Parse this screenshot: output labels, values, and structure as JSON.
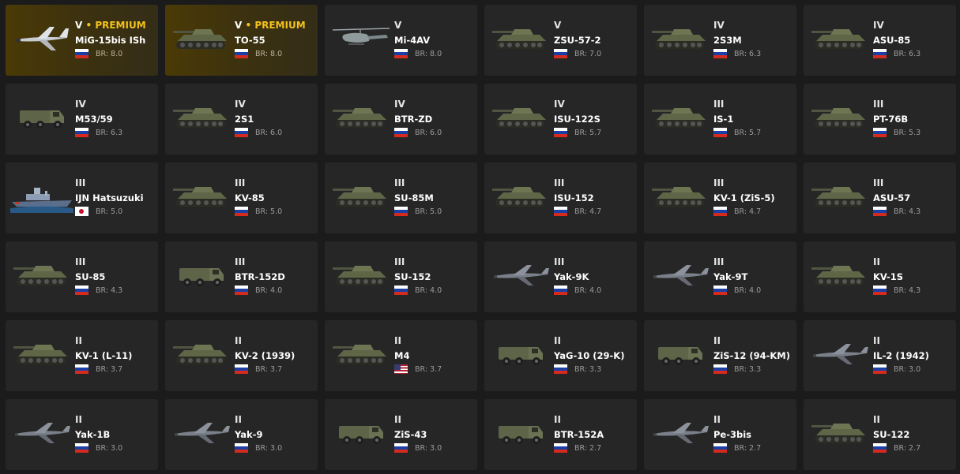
{
  "colors": {
    "background": "#1b1b1b",
    "card": "#262626",
    "premium_card": "#3b3110",
    "premium_text": "#f4c21b",
    "br_text": "#9a9a9a"
  },
  "vehicles": [
    {
      "rank": "V",
      "premium": true,
      "premium_label": "PREMIUM",
      "name": "MiG-15bis ISh",
      "flag": "ussr",
      "br": "BR: 8.0",
      "icon": "jet-icon"
    },
    {
      "rank": "V",
      "premium": true,
      "premium_label": "PREMIUM",
      "name": "TO-55",
      "flag": "ussr",
      "br": "BR: 8.0",
      "icon": "tank-icon"
    },
    {
      "rank": "V",
      "premium": false,
      "name": "Mi-4AV",
      "flag": "ussr",
      "br": "BR: 8.0",
      "icon": "helicopter-icon"
    },
    {
      "rank": "V",
      "premium": false,
      "name": "ZSU-57-2",
      "flag": "ussr",
      "br": "BR: 7.0",
      "icon": "tank-icon"
    },
    {
      "rank": "IV",
      "premium": false,
      "name": "2S3M",
      "flag": "ussr",
      "br": "BR: 6.3",
      "icon": "tank-icon"
    },
    {
      "rank": "IV",
      "premium": false,
      "name": "ASU-85",
      "flag": "ussr",
      "br": "BR: 6.3",
      "icon": "tank-icon"
    },
    {
      "rank": "IV",
      "premium": false,
      "name": "M53/59",
      "flag": "ussr",
      "br": "BR: 6.3",
      "icon": "truck-icon"
    },
    {
      "rank": "IV",
      "premium": false,
      "name": "2S1",
      "flag": "ussr",
      "br": "BR: 6.0",
      "icon": "tank-icon"
    },
    {
      "rank": "IV",
      "premium": false,
      "name": "BTR-ZD",
      "flag": "ussr",
      "br": "BR: 6.0",
      "icon": "tank-icon"
    },
    {
      "rank": "IV",
      "premium": false,
      "name": "ISU-122S",
      "flag": "ussr",
      "br": "BR: 5.7",
      "icon": "tank-icon"
    },
    {
      "rank": "III",
      "premium": false,
      "name": "IS-1",
      "flag": "ussr",
      "br": "BR: 5.7",
      "icon": "tank-icon"
    },
    {
      "rank": "III",
      "premium": false,
      "name": "PT-76B",
      "flag": "ussr",
      "br": "BR: 5.3",
      "icon": "tank-icon"
    },
    {
      "rank": "III",
      "premium": false,
      "name": "IJN Hatsuzuki",
      "flag": "japan",
      "br": "BR: 5.0",
      "icon": "ship-icon"
    },
    {
      "rank": "III",
      "premium": false,
      "name": "KV-85",
      "flag": "ussr",
      "br": "BR: 5.0",
      "icon": "tank-icon"
    },
    {
      "rank": "III",
      "premium": false,
      "name": "SU-85M",
      "flag": "ussr",
      "br": "BR: 5.0",
      "icon": "tank-icon"
    },
    {
      "rank": "III",
      "premium": false,
      "name": "ISU-152",
      "flag": "ussr",
      "br": "BR: 4.7",
      "icon": "tank-icon"
    },
    {
      "rank": "III",
      "premium": false,
      "name": "KV-1 (ZiS-5)",
      "flag": "ussr",
      "br": "BR: 4.7",
      "icon": "tank-icon"
    },
    {
      "rank": "III",
      "premium": false,
      "name": "ASU-57",
      "flag": "ussr",
      "br": "BR: 4.3",
      "icon": "tank-icon"
    },
    {
      "rank": "III",
      "premium": false,
      "name": "SU-85",
      "flag": "ussr",
      "br": "BR: 4.3",
      "icon": "tank-icon"
    },
    {
      "rank": "III",
      "premium": false,
      "name": "BTR-152D",
      "flag": "ussr",
      "br": "BR: 4.0",
      "icon": "truck-icon"
    },
    {
      "rank": "III",
      "premium": false,
      "name": "SU-152",
      "flag": "ussr",
      "br": "BR: 4.0",
      "icon": "tank-icon"
    },
    {
      "rank": "III",
      "premium": false,
      "name": "Yak-9K",
      "flag": "ussr",
      "br": "BR: 4.0",
      "icon": "plane-icon"
    },
    {
      "rank": "III",
      "premium": false,
      "name": "Yak-9T",
      "flag": "ussr",
      "br": "BR: 4.0",
      "icon": "plane-icon"
    },
    {
      "rank": "II",
      "premium": false,
      "name": "KV-1S",
      "flag": "ussr",
      "br": "BR: 4.3",
      "icon": "tank-icon"
    },
    {
      "rank": "II",
      "premium": false,
      "name": "KV-1 (L-11)",
      "flag": "ussr",
      "br": "BR: 3.7",
      "icon": "tank-icon"
    },
    {
      "rank": "II",
      "premium": false,
      "name": "KV-2 (1939)",
      "flag": "ussr",
      "br": "BR: 3.7",
      "icon": "tank-icon"
    },
    {
      "rank": "II",
      "premium": false,
      "name": "M4",
      "flag": "usa",
      "br": "BR: 3.7",
      "icon": "tank-icon"
    },
    {
      "rank": "II",
      "premium": false,
      "name": "YaG-10 (29-K)",
      "flag": "ussr",
      "br": "BR: 3.3",
      "icon": "truck-icon"
    },
    {
      "rank": "II",
      "premium": false,
      "name": "ZiS-12 (94-KM)",
      "flag": "ussr",
      "br": "BR: 3.3",
      "icon": "truck-icon"
    },
    {
      "rank": "II",
      "premium": false,
      "name": "IL-2 (1942)",
      "flag": "ussr",
      "br": "BR: 3.0",
      "icon": "plane-icon"
    },
    {
      "rank": "II",
      "premium": false,
      "name": "Yak-1B",
      "flag": "ussr",
      "br": "BR: 3.0",
      "icon": "plane-icon"
    },
    {
      "rank": "II",
      "premium": false,
      "name": "Yak-9",
      "flag": "ussr",
      "br": "BR: 3.0",
      "icon": "plane-icon"
    },
    {
      "rank": "II",
      "premium": false,
      "name": "ZiS-43",
      "flag": "ussr",
      "br": "BR: 3.0",
      "icon": "truck-icon"
    },
    {
      "rank": "II",
      "premium": false,
      "name": "BTR-152A",
      "flag": "ussr",
      "br": "BR: 2.7",
      "icon": "truck-icon"
    },
    {
      "rank": "II",
      "premium": false,
      "name": "Pe-3bis",
      "flag": "ussr",
      "br": "BR: 2.7",
      "icon": "plane-icon"
    },
    {
      "rank": "II",
      "premium": false,
      "name": "SU-122",
      "flag": "ussr",
      "br": "BR: 2.7",
      "icon": "tank-icon"
    }
  ]
}
